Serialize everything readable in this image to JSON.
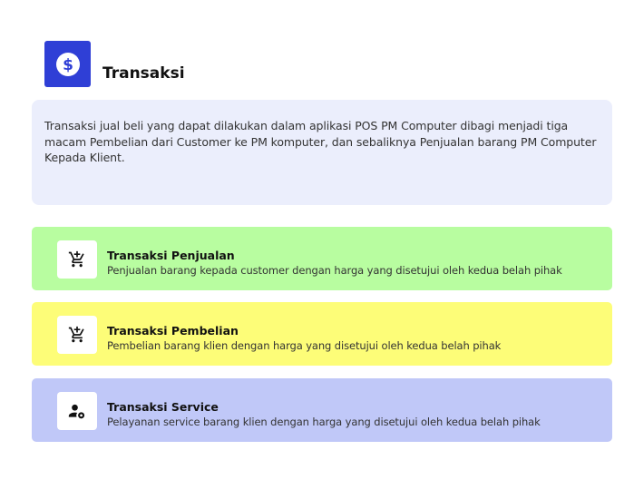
{
  "header": {
    "title": "Transaksi",
    "icon": "dollar-icon",
    "icon_bg": "#2f3fd6"
  },
  "description": "Transaksi jual beli yang dapat dilakukan dalam aplikasi POS PM Computer dibagi menjadi tiga macam Pembelian dari Customer ke PM komputer, dan sebaliknya Penjualan barang PM Computer Kepada Klient.",
  "items": [
    {
      "title": "Transaksi Penjualan",
      "description": "Penjualan barang kepada customer dengan harga yang disetujui oleh kedua belah pihak",
      "icon": "add-to-cart-icon",
      "color": "#b8fda0"
    },
    {
      "title": "Transaksi Pembelian",
      "description": "Pembelian barang klien dengan harga yang disetujui oleh kedua belah pihak",
      "icon": "add-to-cart-icon",
      "color": "#fdfd78"
    },
    {
      "title": "Transaksi Service",
      "description": "Pelayanan service barang klien dengan harga yang disetujui oleh kedua belah pihak",
      "icon": "user-settings-icon",
      "color": "#c0c8f8"
    }
  ]
}
